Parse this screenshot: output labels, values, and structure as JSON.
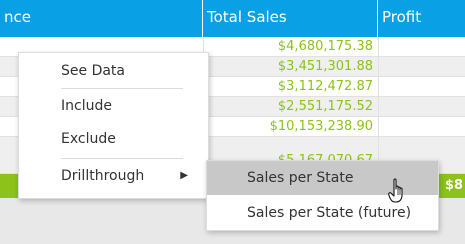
{
  "grid": {
    "columns": [
      {
        "label": "nce"
      },
      {
        "label": "Total Sales"
      },
      {
        "label": "Profit"
      }
    ],
    "total_sales": [
      "$4,680,175.38",
      "$3,451,301.88",
      "$3,112,472.87",
      "$2,551,175.52",
      "$10,153,238.90",
      "$5,167,070.67"
    ],
    "grand_total_fragment": "$8"
  },
  "colors": {
    "header_bg": "#0aa0e6",
    "value_green": "#8cc21a",
    "total_bar": "#8cc21a",
    "hover_gray": "#c8c8c8"
  },
  "context_menu": {
    "items": [
      "See Data",
      "Include",
      "Exclude",
      "Drillthrough"
    ],
    "submenu_arrow": "chevron-right-icon"
  },
  "submenu": {
    "items": [
      "Sales per State",
      "Sales per State (future)"
    ],
    "hovered_index": 0
  },
  "cursor_icon": "hand-pointer-icon"
}
